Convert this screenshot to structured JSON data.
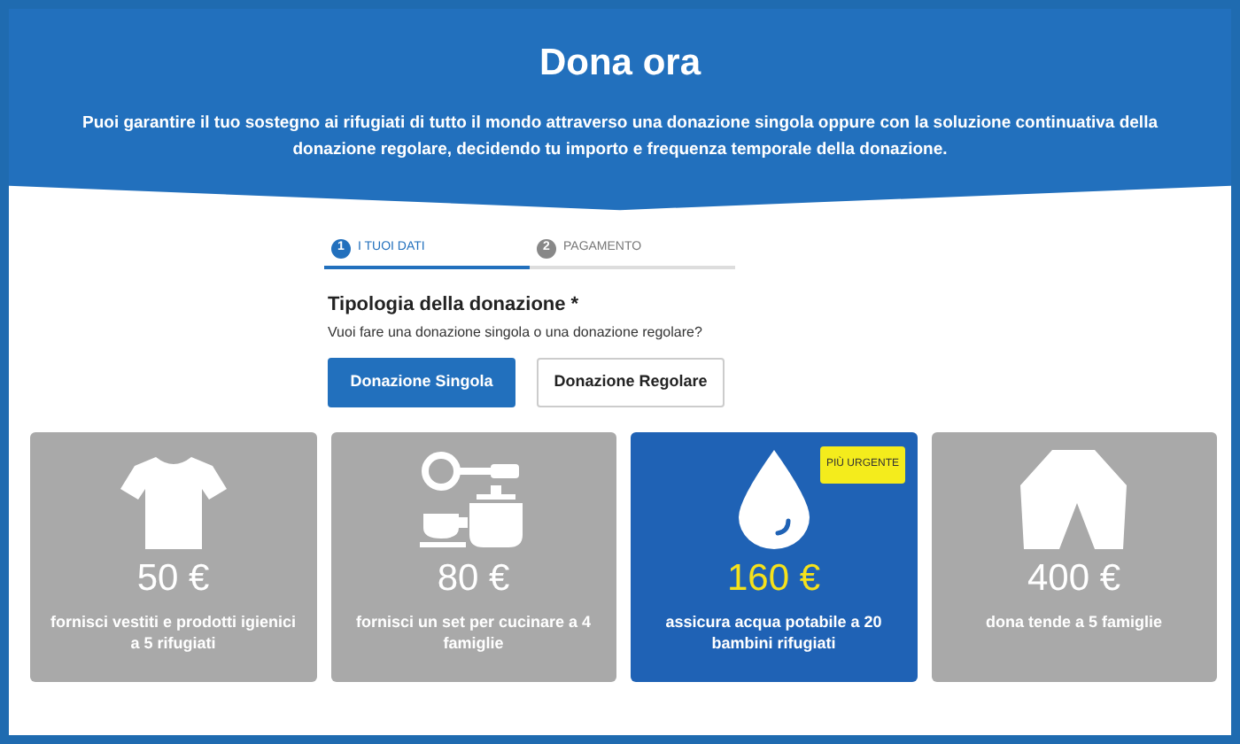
{
  "header": {
    "title": "Dona ora",
    "text": "Puoi garantire il tuo sostegno ai rifugiati di tutto il mondo attraverso una donazione singola oppure con la soluzione continuativa della donazione regolare, decidendo tu importo e frequenza temporale della donazione."
  },
  "steps": [
    {
      "number": "1",
      "label": "I TUOI DATI",
      "selected": true
    },
    {
      "number": "2",
      "label": "PAGAMENTO",
      "selected": false
    }
  ],
  "donation_type": {
    "label": "Tipologia della donazione *",
    "hint": "Vuoi fare una donazione singola o una donazione regolare?",
    "options": [
      {
        "label": "Donazione Singola",
        "selected": true
      },
      {
        "label": "Donazione Regolare",
        "selected": false
      }
    ]
  },
  "amounts": [
    {
      "amount": "50 €",
      "description": "fornisci vestiti e prodotti igienici a 5 rifugiati",
      "selected": false
    },
    {
      "amount": "80 €",
      "description": "fornisci un set per cucinare a 4 famiglie",
      "selected": false
    },
    {
      "amount": "160 €",
      "description": "assicura acqua potabile a 20 bambini rifugiati",
      "selected": true,
      "badge": "PIÙ URGENTE"
    },
    {
      "amount": "400 €",
      "description": "dona tende a 5 famiglie",
      "selected": false
    }
  ]
}
